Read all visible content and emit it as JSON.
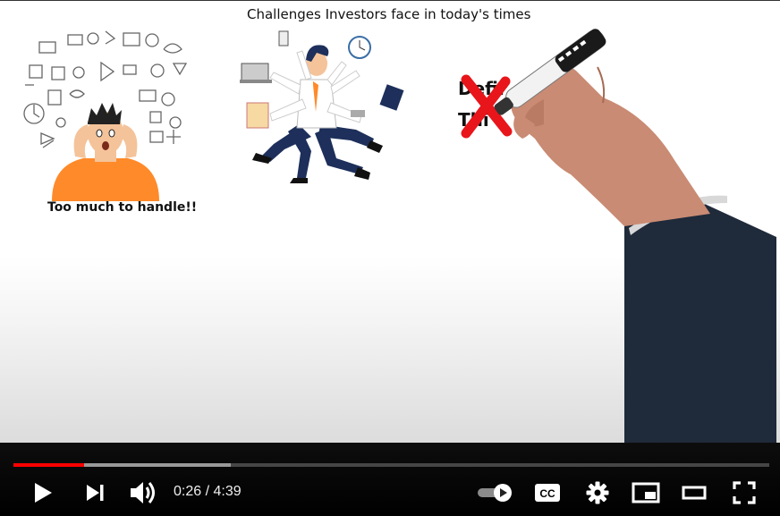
{
  "video": {
    "title_text": "Challenges Investors face in today's times",
    "left_caption": "Too much to handle!!",
    "partial_word_1": "Defir",
    "partial_word_2": "Thi"
  },
  "player": {
    "current_time": "0:26",
    "separator": " / ",
    "duration": "4:39",
    "progress_played": 0.093,
    "progress_buffered": 0.287,
    "autoplay_on": true,
    "accent_color": "#ff0000"
  },
  "icons": [
    "play-icon",
    "next-icon",
    "volume-icon",
    "autoplay-toggle-icon",
    "captions-icon",
    "settings-icon",
    "miniplayer-icon",
    "theater-icon",
    "fullscreen-icon"
  ]
}
